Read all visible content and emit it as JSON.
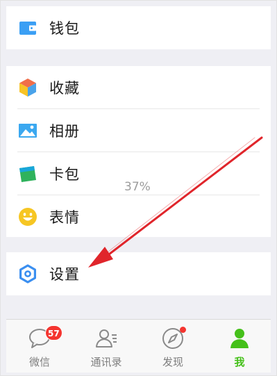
{
  "menu": {
    "wallet": {
      "label": "钱包",
      "icon": "wallet-icon",
      "color": "#3b9ff4"
    },
    "favorites": {
      "label": "收藏",
      "icon": "cube-icon",
      "color": "#f4a341"
    },
    "album": {
      "label": "相册",
      "icon": "picture-icon",
      "color": "#3ba8f0"
    },
    "cards": {
      "label": "卡包",
      "icon": "card-icon",
      "color": "#2fb25c"
    },
    "stickers": {
      "label": "表情",
      "icon": "smiley-icon",
      "color": "#f6c623"
    },
    "settings": {
      "label": "设置",
      "icon": "gear-icon",
      "color": "#3b8ff0"
    }
  },
  "overlay": {
    "percent": "37%",
    "arrow_color": "#e0252b",
    "arrow_target": "settings"
  },
  "tabbar": {
    "tabs": [
      {
        "label": "微信",
        "icon": "chat-bubble-icon",
        "badge": "57"
      },
      {
        "label": "通讯录",
        "icon": "contacts-icon"
      },
      {
        "label": "发现",
        "icon": "compass-icon",
        "dot": true
      },
      {
        "label": "我",
        "icon": "person-icon",
        "active": true
      }
    ],
    "active_color": "#45c01a"
  }
}
